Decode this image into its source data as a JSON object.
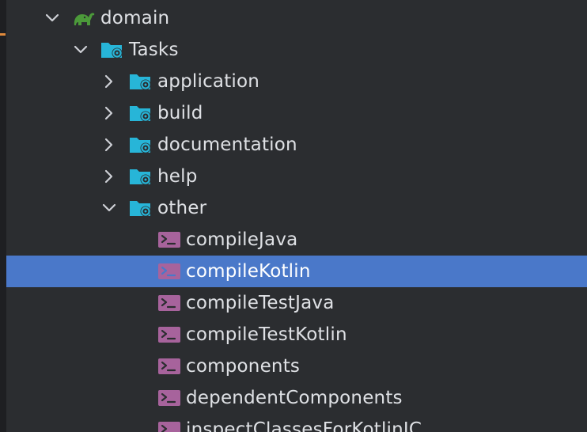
{
  "colors": {
    "background": "#2b2d30",
    "selection": "#4a78c9",
    "folder_icon": "#27b5d8",
    "task_icon": "#a7639c",
    "gradle_icon": "#4c9a3a",
    "gutter_marker": "#e08a3c"
  },
  "tree": {
    "project": {
      "label": "domain",
      "expanded": true,
      "icon": "gradle-elephant-icon"
    },
    "tasks_group": {
      "label": "Tasks",
      "expanded": true,
      "icon": "task-folder-icon"
    },
    "task_groups": [
      {
        "label": "application",
        "expanded": false
      },
      {
        "label": "build",
        "expanded": false
      },
      {
        "label": "documentation",
        "expanded": false
      },
      {
        "label": "help",
        "expanded": false
      },
      {
        "label": "other",
        "expanded": true
      }
    ],
    "other_tasks": [
      {
        "label": "compileJava",
        "selected": false
      },
      {
        "label": "compileKotlin",
        "selected": true
      },
      {
        "label": "compileTestJava",
        "selected": false
      },
      {
        "label": "compileTestKotlin",
        "selected": false
      },
      {
        "label": "components",
        "selected": false
      },
      {
        "label": "dependentComponents",
        "selected": false
      },
      {
        "label": "inspectClassesForKotlinIC",
        "selected": false
      }
    ]
  }
}
